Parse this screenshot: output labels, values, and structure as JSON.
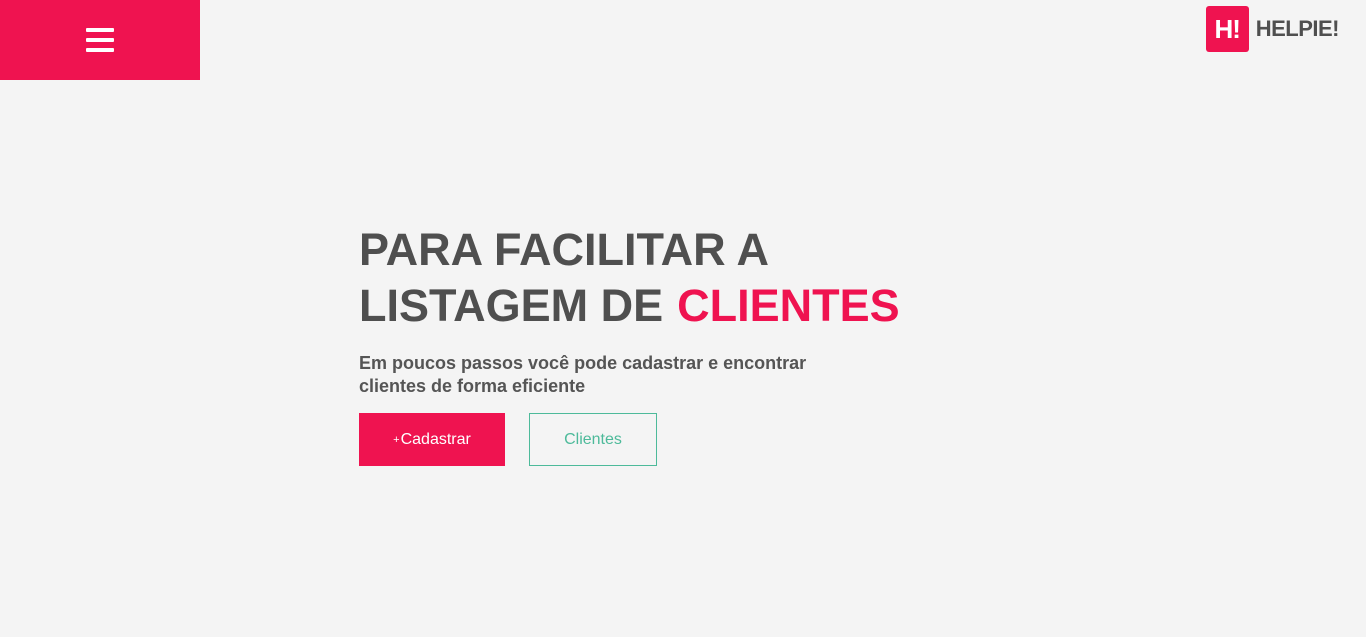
{
  "nav": {
    "menu_icon": "hamburger-menu-icon"
  },
  "brand": {
    "mark": "H!",
    "name": "HELPIE!"
  },
  "hero": {
    "title_line1": "PARA FACILITAR A",
    "title_line2": "LISTAGEM DE",
    "title_highlight": "CLIENTES",
    "subtitle_line1": "Em poucos passos você pode cadastrar e encontrar",
    "subtitle_line2": "clientes de forma eficiente"
  },
  "actions": {
    "register_plus": "+",
    "register_label": "Cadastrar",
    "clients_label": "Clientes"
  },
  "colors": {
    "accent": "#ef1350",
    "secondary": "#4dba9a",
    "text": "#4f4f4f",
    "background": "#f4f4f4"
  }
}
